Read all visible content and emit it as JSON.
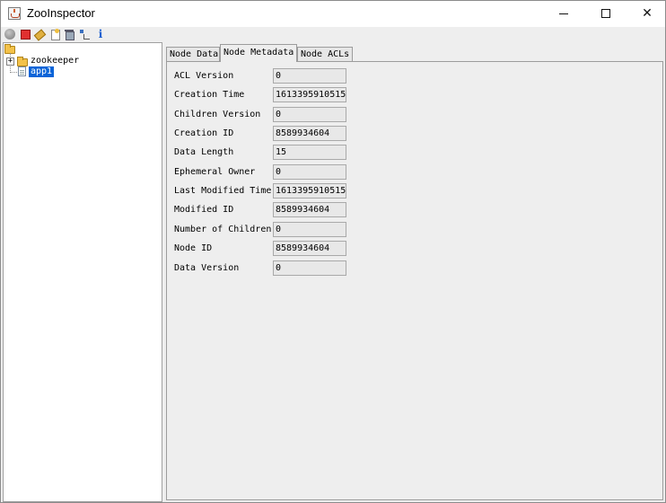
{
  "window": {
    "title": "ZooInspector",
    "controls": {
      "minimize": "—",
      "maximize": "☐",
      "close": "✕"
    }
  },
  "toolbar": {
    "items": [
      {
        "name": "connect",
        "icon": "connect-icon"
      },
      {
        "name": "disconnect",
        "icon": "disconnect-icon"
      },
      {
        "name": "refresh",
        "icon": "refresh-icon"
      },
      {
        "name": "add-node",
        "icon": "add-node-icon"
      },
      {
        "name": "delete-node",
        "icon": "delete-node-icon"
      },
      {
        "name": "node-viewers",
        "icon": "node-viewers-icon"
      },
      {
        "name": "about",
        "icon": "info-icon",
        "glyph": "i"
      }
    ]
  },
  "tree": {
    "expander": "+",
    "nodes": [
      {
        "label": "zookeeper",
        "type": "folder",
        "expanded": false
      },
      {
        "label": "app1",
        "type": "file",
        "selected": true
      }
    ]
  },
  "tabs": [
    {
      "label": "Node Data",
      "active": false
    },
    {
      "label": "Node Metadata",
      "active": true
    },
    {
      "label": "Node ACLs",
      "active": false
    }
  ],
  "metadata": [
    {
      "label": "ACL Version",
      "value": "0"
    },
    {
      "label": "Creation Time",
      "value": "1613395910515"
    },
    {
      "label": "Children Version",
      "value": "0"
    },
    {
      "label": "Creation ID",
      "value": "8589934604"
    },
    {
      "label": "Data Length",
      "value": "15"
    },
    {
      "label": "Ephemeral Owner",
      "value": "0"
    },
    {
      "label": "Last Modified Time",
      "value": "1613395910515"
    },
    {
      "label": "Modified ID",
      "value": "8589934604"
    },
    {
      "label": "Number of Children",
      "value": "0"
    },
    {
      "label": "Node ID",
      "value": "8589934604"
    },
    {
      "label": "Data Version",
      "value": "0"
    }
  ],
  "colors": {
    "selection": "#0a64d8",
    "panel_bg": "#eeeeee",
    "field_bg": "#e8e8e8",
    "border": "#9c9c9c"
  }
}
